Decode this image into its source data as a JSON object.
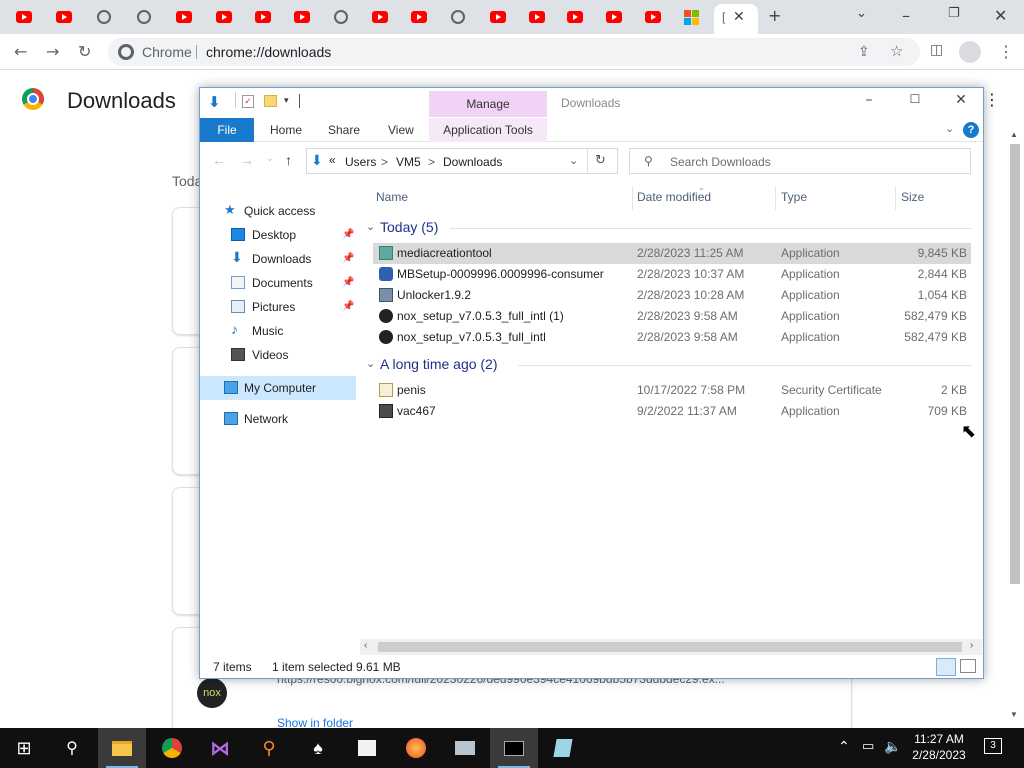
{
  "browser": {
    "active_tab_label": "[",
    "new_tab_symbol": "+",
    "omnibox_site": "Chrome",
    "omnibox_url": "chrome://downloads"
  },
  "chrome_page": {
    "title": "Downloads",
    "today_label": "Toda",
    "partial_url": "https://res00.bignox.com/full/20230226/ded990e394ce41069bdb5b73ddbdec29.ex...",
    "show_in_folder": "Show in folder",
    "nox_logo_text": "nox"
  },
  "explorer": {
    "title": "Downloads",
    "manage_tab": "Manage",
    "ribbon": {
      "file": "File",
      "home": "Home",
      "share": "Share",
      "view": "View",
      "app_tools": "Application Tools"
    },
    "address": {
      "overflow": "«",
      "crumbs": [
        "Users",
        "VM5",
        "Downloads"
      ],
      "separator": ">"
    },
    "search_placeholder": "Search Downloads",
    "nav": {
      "quick_access": "Quick access",
      "desktop": "Desktop",
      "downloads": "Downloads",
      "documents": "Documents",
      "pictures": "Pictures",
      "music": "Music",
      "videos": "Videos",
      "my_computer": "My Computer",
      "network": "Network"
    },
    "columns": {
      "name": "Name",
      "date": "Date modified",
      "type": "Type",
      "size": "Size"
    },
    "groups": {
      "today": "Today (5)",
      "long_ago": "A long time ago (2)"
    },
    "files_today": [
      {
        "name": "mediacreationtool",
        "date": "2/28/2023 11:25 AM",
        "type": "Application",
        "size": "9,845 KB"
      },
      {
        "name": "MBSetup-0009996.0009996-consumer",
        "date": "2/28/2023 10:37 AM",
        "type": "Application",
        "size": "2,844 KB"
      },
      {
        "name": "Unlocker1.9.2",
        "date": "2/28/2023 10:28 AM",
        "type": "Application",
        "size": "1,054 KB"
      },
      {
        "name": "nox_setup_v7.0.5.3_full_intl (1)",
        "date": "2/28/2023 9:58 AM",
        "type": "Application",
        "size": "582,479 KB"
      },
      {
        "name": "nox_setup_v7.0.5.3_full_intl",
        "date": "2/28/2023 9:58 AM",
        "type": "Application",
        "size": "582,479 KB"
      }
    ],
    "files_old": [
      {
        "name": "penis",
        "date": "10/17/2022 7:58 PM",
        "type": "Security Certificate",
        "size": "2 KB"
      },
      {
        "name": "vac467",
        "date": "9/2/2022 11:37 AM",
        "type": "Application",
        "size": "709 KB"
      }
    ],
    "status": {
      "items": "7 items",
      "selected": "1 item selected",
      "selected_size": "9.61 MB"
    }
  },
  "taskbar": {
    "time": "11:27 AM",
    "date": "2/28/2023",
    "notifications": "3"
  }
}
